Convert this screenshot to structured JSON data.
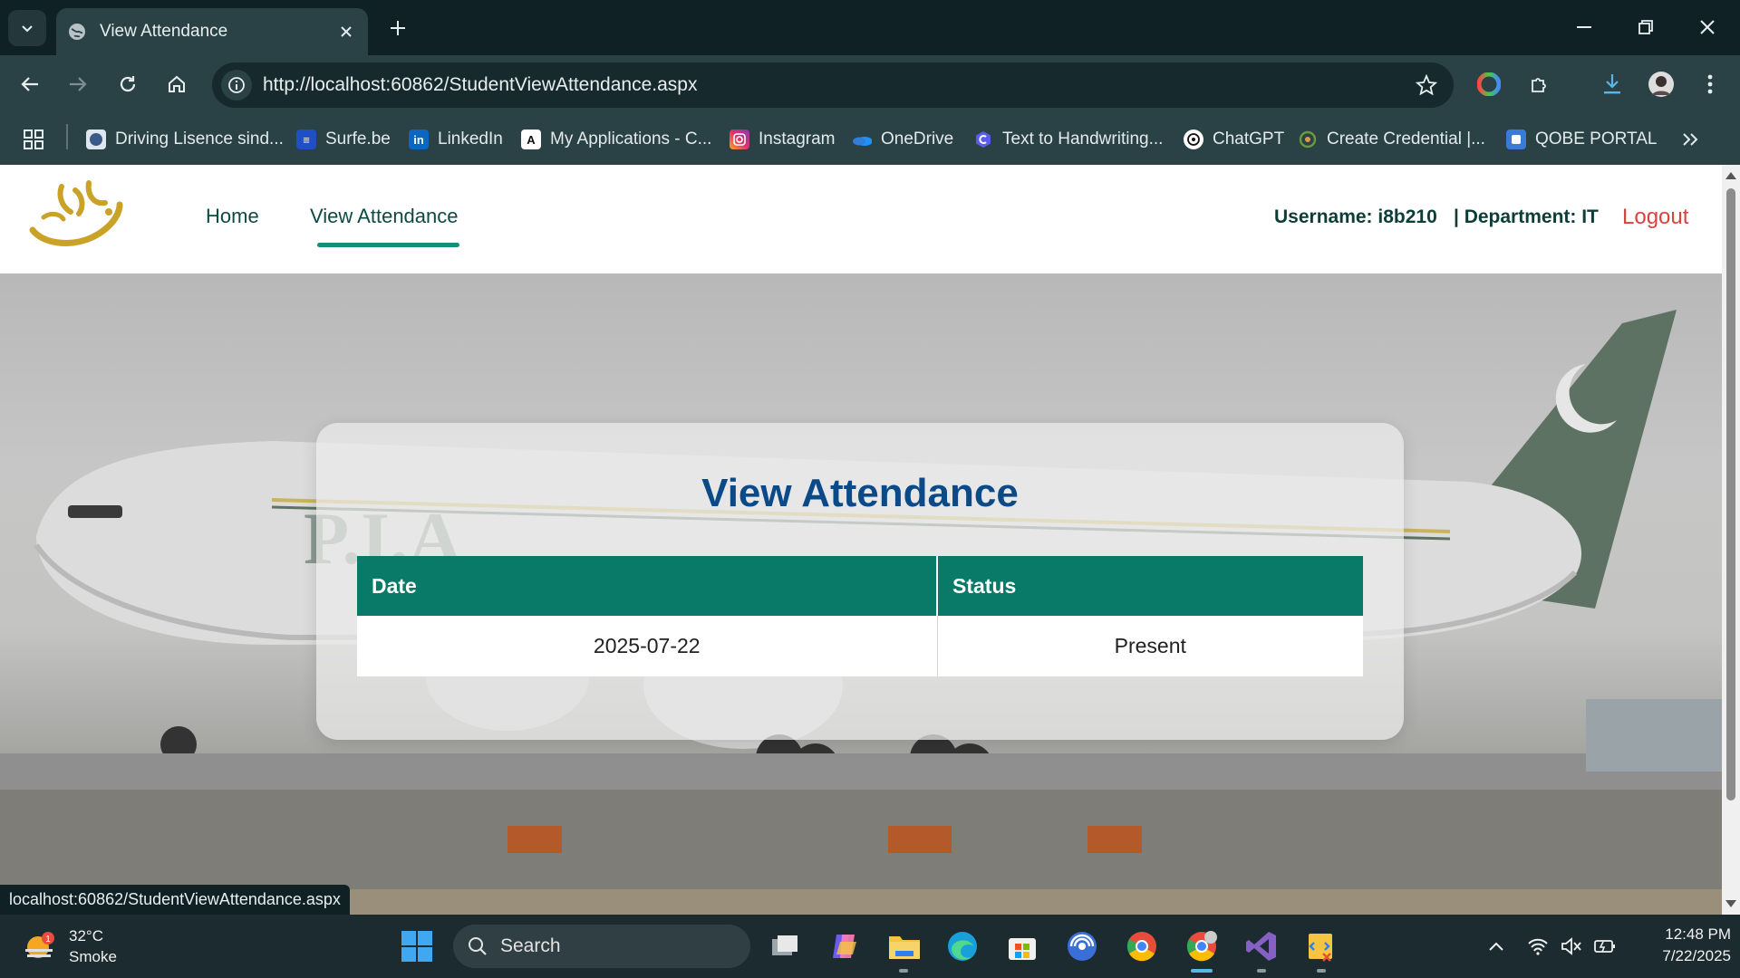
{
  "browser": {
    "tab_title": "View Attendance",
    "url": "http://localhost:60862/StudentViewAttendance.aspx",
    "status_url": "localhost:60862/StudentViewAttendance.aspx",
    "bookmarks": [
      {
        "label": "Driving Lisence sind...",
        "icon": "government-seal-icon",
        "color": "#3b5a8a"
      },
      {
        "label": "Surfe.be",
        "icon": "surfe-icon",
        "color": "#1f4fc4"
      },
      {
        "label": "LinkedIn",
        "icon": "linkedin-icon",
        "color": "#0a66c2"
      },
      {
        "label": "My Applications - C...",
        "icon": "application-icon",
        "color": "#ffffff"
      },
      {
        "label": "Instagram",
        "icon": "instagram-icon",
        "color": "#e1306c"
      },
      {
        "label": "OneDrive",
        "icon": "onedrive-icon",
        "color": "#1e90ff"
      },
      {
        "label": "Text to Handwriting...",
        "icon": "handwriting-icon",
        "color": "#5b5bf0"
      },
      {
        "label": "ChatGPT",
        "icon": "chatgpt-icon",
        "color": "#ffffff"
      },
      {
        "label": "Create Credential |...",
        "icon": "credential-icon",
        "color": "#6a9a3a"
      },
      {
        "label": "QOBE PORTAL",
        "icon": "portal-icon",
        "color": "#3a7bd5"
      }
    ]
  },
  "site": {
    "nav": {
      "home": "Home",
      "view_attendance": "View Attendance"
    },
    "user": {
      "username": "Username: i8b210",
      "department": "| Department: IT",
      "logout": "Logout"
    },
    "accent": "#0a7a68",
    "title_color": "#0b4a88",
    "logout_color": "#d9433f"
  },
  "attendance": {
    "title": "View Attendance",
    "columns": [
      "Date",
      "Status"
    ],
    "rows": [
      {
        "date": "2025-07-22",
        "status": "Present"
      }
    ]
  },
  "taskbar": {
    "weather_temp": "32°C",
    "weather_desc": "Smoke",
    "weather_badge": "1",
    "search_label": "Search",
    "time": "12:48 PM",
    "date": "7/22/2025"
  }
}
